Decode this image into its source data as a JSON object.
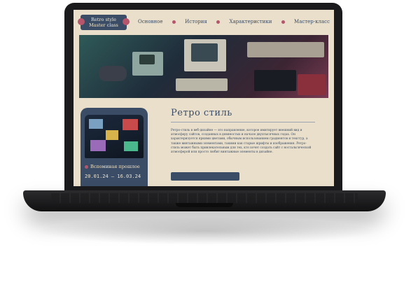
{
  "logo": {
    "line1": "Retro style",
    "line2": "Master class"
  },
  "nav": {
    "items": [
      {
        "label": "Основное"
      },
      {
        "label": "История"
      },
      {
        "label": "Характеристики"
      },
      {
        "label": "Мастер-класс"
      }
    ]
  },
  "card": {
    "label": "Вспоминая прошлое",
    "dates": "20.01.24 — 16.03.24"
  },
  "article": {
    "title": "Ретро стиль",
    "body": "Ретро-стиль в веб-дизайне — это направление, которое имитирует внешний вид и атмосферу сайтов, созданных в девяностых и начале двухтысячных годах. Он характеризуется яркими цветами, обычным использованием градиентов и текстур, а также винтажными элементами, такими как старые шрифты и изображения. Ретро-стиль может быть привлекательным для тех, кто хочет создать сайт с ностальгической атмосферой или просто любит винтажные элементы в дизайне."
  },
  "colors": {
    "accent": "#3b4d66",
    "dot": "#b5566c",
    "background": "#e9dfcb"
  }
}
